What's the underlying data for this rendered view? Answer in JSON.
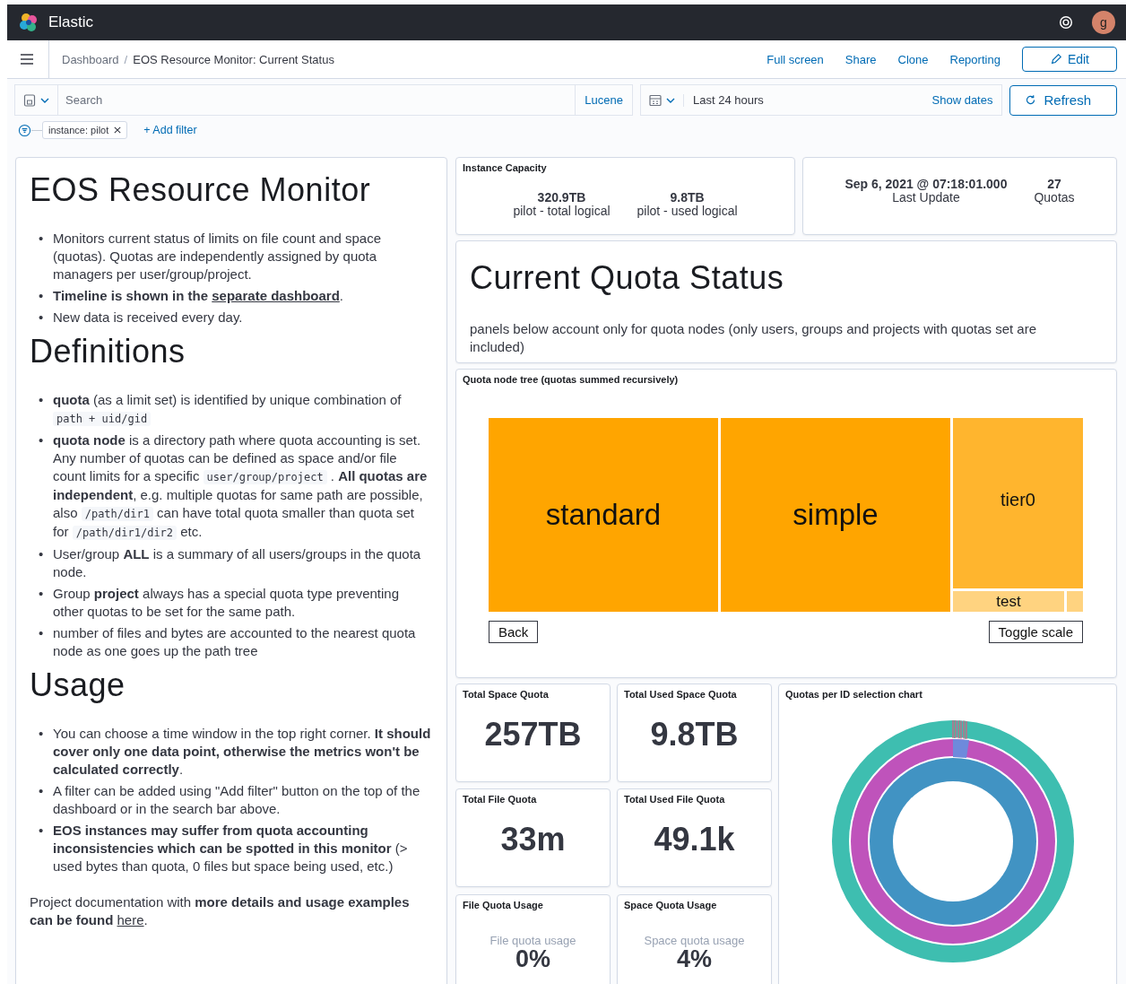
{
  "header": {
    "app_name": "Elastic",
    "avatar_initial": "g"
  },
  "breadcrumbs": {
    "items": [
      "Dashboard",
      "EOS Resource Monitor: Current Status"
    ],
    "separator": "/"
  },
  "top_links": [
    "Full screen",
    "Share",
    "Clone",
    "Reporting"
  ],
  "edit_button": "Edit",
  "query_bar": {
    "placeholder": "Search",
    "language": "Lucene",
    "time_range": "Last 24 hours",
    "show_dates": "Show dates",
    "refresh": "Refresh"
  },
  "filters": [
    {
      "label": "instance: pilot"
    }
  ],
  "add_filter": "+ Add filter",
  "markdown_panel": {
    "bullet": "•",
    "sections": [
      {
        "heading": "EOS Resource Monitor",
        "items": [
          [
            {
              "kind": "text",
              "text": "Monitors current status of limits on file count and space (quotas). Quotas are independently assigned by quota managers per user/group/project."
            }
          ],
          [
            {
              "kind": "text",
              "text": "**Timeline is shown in the** "
            },
            {
              "kind": "link",
              "text": "**separate dashboard**"
            },
            {
              "kind": "text",
              "text": "."
            }
          ],
          [
            {
              "kind": "text",
              "text": "New data is received every day."
            }
          ]
        ]
      },
      {
        "heading": "Definitions",
        "items": [
          [
            {
              "kind": "text",
              "text": "**quota** (as a limit set) is identified by unique combination of "
            },
            {
              "kind": "code",
              "text": "path + uid/gid"
            }
          ],
          [
            {
              "kind": "text",
              "text": "**quota node** is a directory path where quota accounting is set. Any number of quotas can be defined as space and/or file count limits for a specific "
            },
            {
              "kind": "code",
              "text": "user/group/project"
            },
            {
              "kind": "text",
              "text": " . **All quotas are independent**, e.g. multiple quotas for same path are possible, also "
            },
            {
              "kind": "code",
              "text": "/path/dir1"
            },
            {
              "kind": "text",
              "text": " can have total quota smaller than quota set for "
            },
            {
              "kind": "code",
              "text": "/path/dir1/dir2"
            },
            {
              "kind": "text",
              "text": " etc."
            }
          ],
          [
            {
              "kind": "text",
              "text": "User/group **ALL** is a summary of all users/groups in the quota node."
            }
          ],
          [
            {
              "kind": "text",
              "text": "Group **project** always has a special quota type preventing other quotas to be set for the same path."
            }
          ],
          [
            {
              "kind": "text",
              "text": "number of files and bytes are accounted to the nearest quota node as one goes up the path tree"
            }
          ]
        ]
      },
      {
        "heading": "Usage",
        "items": [
          [
            {
              "kind": "text",
              "text": "You can choose a time window in the top right corner. **It should cover only one data point, otherwise the metrics won't be calculated correctly**."
            }
          ],
          [
            {
              "kind": "text",
              "text": "A filter can be added using \"Add filter\" button on the top of the dashboard or in the search bar above."
            }
          ],
          [
            {
              "kind": "text",
              "text": "**EOS instances may suffer from quota accounting inconsistencies which can be spotted in this monitor** (> used bytes than quota, 0 files but space being used, etc.)"
            }
          ]
        ]
      }
    ],
    "note": [
      {
        "kind": "text",
        "text": "Project documentation with **more details and usage examples can be found** "
      },
      {
        "kind": "link",
        "text": "here"
      },
      {
        "kind": "text",
        "text": "."
      }
    ]
  },
  "instance_capacity": {
    "title": "Instance Capacity",
    "metrics": [
      {
        "value": "320.9TB",
        "label": "pilot - total logical"
      },
      {
        "value": "9.8TB",
        "label": "pilot - used logical"
      }
    ]
  },
  "status_metrics": [
    {
      "value": "Sep 6, 2021 @ 07:18:01.000",
      "label": "Last Update"
    },
    {
      "value": "27",
      "label": "Quotas"
    }
  ],
  "quota_status": {
    "heading": "Current Quota Status",
    "text": "panels below account only for quota nodes (only users, groups and projects with quotas set are included)"
  },
  "treemap": {
    "title": "Quota node tree (quotas summed recursively)",
    "nodes": [
      {
        "label": "standard",
        "color": "#ffa500"
      },
      {
        "label": "simple",
        "color": "#ffa500"
      },
      {
        "label": "tier0",
        "color": "#ffb52e"
      },
      {
        "label": "test",
        "color": "#ffd380"
      }
    ],
    "buttons": [
      "Back",
      "Toggle scale"
    ]
  },
  "stat_cards": [
    {
      "title": "Total Space Quota",
      "kind": "big",
      "value": "257TB"
    },
    {
      "title": "Total Used Space Quota",
      "kind": "big",
      "value": "9.8TB"
    },
    {
      "title": "Total File Quota",
      "kind": "big",
      "value": "33m"
    },
    {
      "title": "Total Used File Quota",
      "kind": "big",
      "value": "49.1k"
    },
    {
      "title": "File Quota Usage",
      "kind": "gauge",
      "caption": "File quota usage",
      "value": "0%"
    },
    {
      "title": "Space Quota Usage",
      "kind": "gauge",
      "caption": "Space quota usage",
      "value": "4%"
    }
  ],
  "sunburst": {
    "title": "Quotas per ID selection chart"
  }
}
